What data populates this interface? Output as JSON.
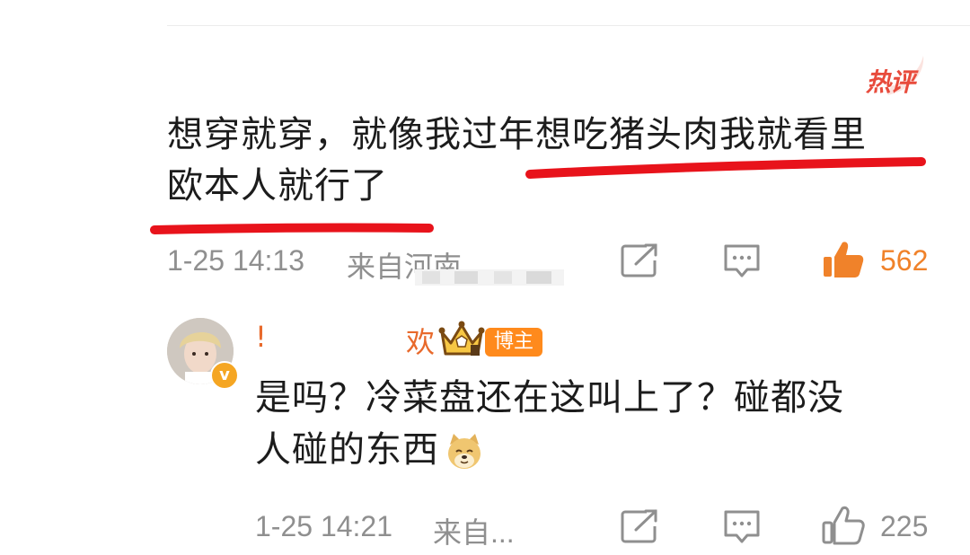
{
  "hot_badge": {
    "label": "热评",
    "icon": "hot-comment-badge"
  },
  "comment": {
    "line1": "想穿就穿，就像我过年想吃猪头肉我就看里",
    "line2": "欧本人就行了",
    "time": "1-25 14:13",
    "location": "来自河南",
    "likes": "562",
    "liked": true,
    "colors": {
      "liked": "#f0822a",
      "underline": "#e8131b",
      "meta": "#8f8f8f"
    }
  },
  "reply": {
    "username_first": "!",
    "username_last": "欢",
    "badge_label": "博主",
    "line1": "是吗？冷菜盘还在这叫上了？碰都没",
    "line2": "人碰的东西",
    "emoji": "doge-emoji",
    "time": "1-25 14:21",
    "location": "来自...",
    "likes": "225",
    "liked": false
  },
  "icons": [
    "share-icon",
    "comment-icon",
    "like-icon",
    "crown-icon",
    "verified-icon"
  ]
}
